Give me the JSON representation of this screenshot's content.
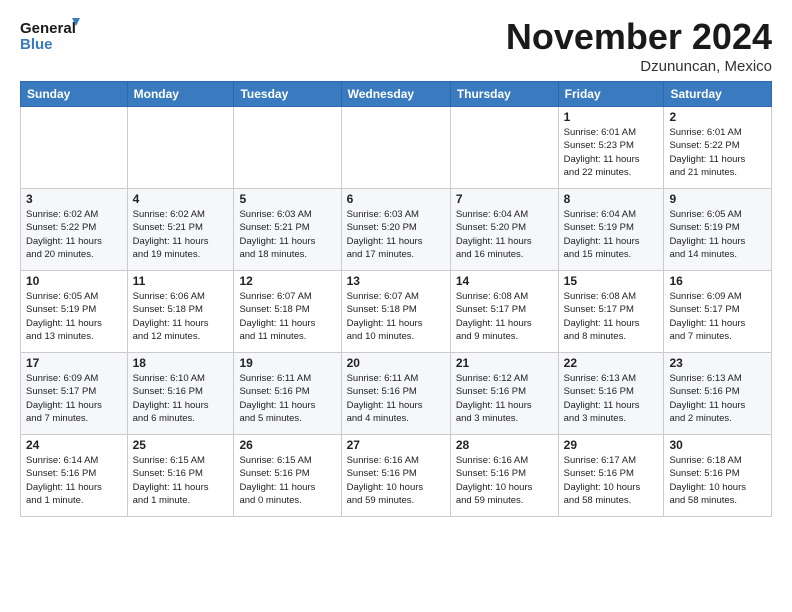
{
  "logo": {
    "line1": "General",
    "line2": "Blue"
  },
  "title": "November 2024",
  "location": "Dzununcan, Mexico",
  "weekdays": [
    "Sunday",
    "Monday",
    "Tuesday",
    "Wednesday",
    "Thursday",
    "Friday",
    "Saturday"
  ],
  "weeks": [
    [
      {
        "day": "",
        "info": ""
      },
      {
        "day": "",
        "info": ""
      },
      {
        "day": "",
        "info": ""
      },
      {
        "day": "",
        "info": ""
      },
      {
        "day": "",
        "info": ""
      },
      {
        "day": "1",
        "info": "Sunrise: 6:01 AM\nSunset: 5:23 PM\nDaylight: 11 hours\nand 22 minutes."
      },
      {
        "day": "2",
        "info": "Sunrise: 6:01 AM\nSunset: 5:22 PM\nDaylight: 11 hours\nand 21 minutes."
      }
    ],
    [
      {
        "day": "3",
        "info": "Sunrise: 6:02 AM\nSunset: 5:22 PM\nDaylight: 11 hours\nand 20 minutes."
      },
      {
        "day": "4",
        "info": "Sunrise: 6:02 AM\nSunset: 5:21 PM\nDaylight: 11 hours\nand 19 minutes."
      },
      {
        "day": "5",
        "info": "Sunrise: 6:03 AM\nSunset: 5:21 PM\nDaylight: 11 hours\nand 18 minutes."
      },
      {
        "day": "6",
        "info": "Sunrise: 6:03 AM\nSunset: 5:20 PM\nDaylight: 11 hours\nand 17 minutes."
      },
      {
        "day": "7",
        "info": "Sunrise: 6:04 AM\nSunset: 5:20 PM\nDaylight: 11 hours\nand 16 minutes."
      },
      {
        "day": "8",
        "info": "Sunrise: 6:04 AM\nSunset: 5:19 PM\nDaylight: 11 hours\nand 15 minutes."
      },
      {
        "day": "9",
        "info": "Sunrise: 6:05 AM\nSunset: 5:19 PM\nDaylight: 11 hours\nand 14 minutes."
      }
    ],
    [
      {
        "day": "10",
        "info": "Sunrise: 6:05 AM\nSunset: 5:19 PM\nDaylight: 11 hours\nand 13 minutes."
      },
      {
        "day": "11",
        "info": "Sunrise: 6:06 AM\nSunset: 5:18 PM\nDaylight: 11 hours\nand 12 minutes."
      },
      {
        "day": "12",
        "info": "Sunrise: 6:07 AM\nSunset: 5:18 PM\nDaylight: 11 hours\nand 11 minutes."
      },
      {
        "day": "13",
        "info": "Sunrise: 6:07 AM\nSunset: 5:18 PM\nDaylight: 11 hours\nand 10 minutes."
      },
      {
        "day": "14",
        "info": "Sunrise: 6:08 AM\nSunset: 5:17 PM\nDaylight: 11 hours\nand 9 minutes."
      },
      {
        "day": "15",
        "info": "Sunrise: 6:08 AM\nSunset: 5:17 PM\nDaylight: 11 hours\nand 8 minutes."
      },
      {
        "day": "16",
        "info": "Sunrise: 6:09 AM\nSunset: 5:17 PM\nDaylight: 11 hours\nand 7 minutes."
      }
    ],
    [
      {
        "day": "17",
        "info": "Sunrise: 6:09 AM\nSunset: 5:17 PM\nDaylight: 11 hours\nand 7 minutes."
      },
      {
        "day": "18",
        "info": "Sunrise: 6:10 AM\nSunset: 5:16 PM\nDaylight: 11 hours\nand 6 minutes."
      },
      {
        "day": "19",
        "info": "Sunrise: 6:11 AM\nSunset: 5:16 PM\nDaylight: 11 hours\nand 5 minutes."
      },
      {
        "day": "20",
        "info": "Sunrise: 6:11 AM\nSunset: 5:16 PM\nDaylight: 11 hours\nand 4 minutes."
      },
      {
        "day": "21",
        "info": "Sunrise: 6:12 AM\nSunset: 5:16 PM\nDaylight: 11 hours\nand 3 minutes."
      },
      {
        "day": "22",
        "info": "Sunrise: 6:13 AM\nSunset: 5:16 PM\nDaylight: 11 hours\nand 3 minutes."
      },
      {
        "day": "23",
        "info": "Sunrise: 6:13 AM\nSunset: 5:16 PM\nDaylight: 11 hours\nand 2 minutes."
      }
    ],
    [
      {
        "day": "24",
        "info": "Sunrise: 6:14 AM\nSunset: 5:16 PM\nDaylight: 11 hours\nand 1 minute."
      },
      {
        "day": "25",
        "info": "Sunrise: 6:15 AM\nSunset: 5:16 PM\nDaylight: 11 hours\nand 1 minute."
      },
      {
        "day": "26",
        "info": "Sunrise: 6:15 AM\nSunset: 5:16 PM\nDaylight: 11 hours\nand 0 minutes."
      },
      {
        "day": "27",
        "info": "Sunrise: 6:16 AM\nSunset: 5:16 PM\nDaylight: 10 hours\nand 59 minutes."
      },
      {
        "day": "28",
        "info": "Sunrise: 6:16 AM\nSunset: 5:16 PM\nDaylight: 10 hours\nand 59 minutes."
      },
      {
        "day": "29",
        "info": "Sunrise: 6:17 AM\nSunset: 5:16 PM\nDaylight: 10 hours\nand 58 minutes."
      },
      {
        "day": "30",
        "info": "Sunrise: 6:18 AM\nSunset: 5:16 PM\nDaylight: 10 hours\nand 58 minutes."
      }
    ]
  ]
}
